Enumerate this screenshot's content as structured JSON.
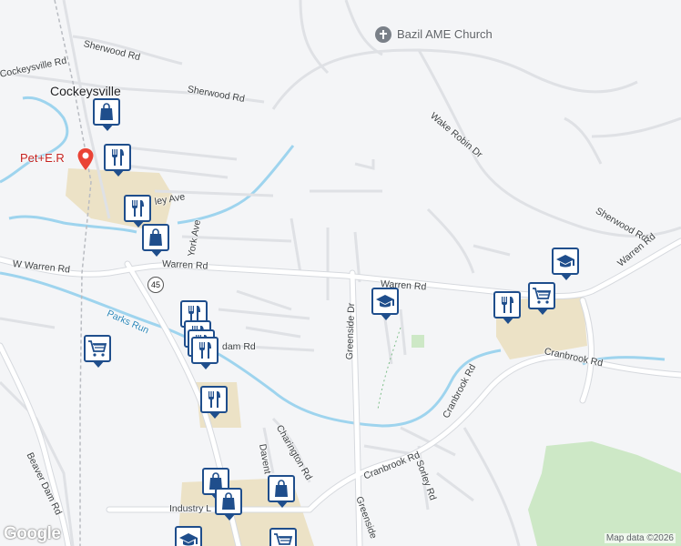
{
  "map": {
    "logo": "Google",
    "attribution": "Map data ©2026",
    "colors": {
      "road": "#ffffff",
      "road_edge": "#d6d9de",
      "water": "#9ed4ee",
      "park": "#cde8c6",
      "commercial": "#ece2c6",
      "marker": "#1f4e8c",
      "pin": "#ea4335"
    }
  },
  "places": {
    "town": "Cockeysville",
    "church": "Bazil AME Church",
    "vet": "Pet+E.R"
  },
  "roads": {
    "sherwood_rd_1": "Sherwood Rd",
    "sherwood_rd_2": "Sherwood Rd",
    "sherwood_rd_3": "Sherwood Rd",
    "cockeysville_rd": "Cockeysville Rd",
    "wake_robin_dr": "Wake Robin Dr",
    "valley_ave": "ley Ave",
    "york_ave": "York Ave",
    "warren_rd_w": "W Warren Rd",
    "warren_rd": "Warren Rd",
    "warren_rd_mid": "Warren Rd",
    "warren_rd_e": "Warren Rd",
    "parks_run": "Parks Run",
    "greenside_dr": "Greenside Dr",
    "greenside_dr_2": "Greenside",
    "dam_rd": "dam Rd",
    "cranbrook_rd_1": "Cranbrook Rd",
    "cranbrook_rd_2": "Cranbrook Rd",
    "cranbrook_rd_3": "Cranbrook Rd",
    "charington_rd": "Charington Rd",
    "daventry": "Davent",
    "beaver_dam_rd": "Beaver Dam Rd",
    "sorley_rd": "Sorley Rd",
    "industry_ln": "Industry L",
    "route_45": "45"
  },
  "markers": [
    {
      "type": "shopping-bag",
      "name": "shopping-marker"
    },
    {
      "type": "restaurant",
      "name": "restaurant-marker"
    },
    {
      "type": "restaurant",
      "name": "restaurant-marker"
    },
    {
      "type": "shopping-bag",
      "name": "shopping-marker"
    },
    {
      "type": "school",
      "name": "school-marker"
    },
    {
      "type": "school",
      "name": "school-marker"
    },
    {
      "type": "restaurant",
      "name": "restaurant-marker"
    },
    {
      "type": "grocery",
      "name": "grocery-marker"
    },
    {
      "type": "restaurant",
      "name": "restaurant-marker"
    },
    {
      "type": "restaurant",
      "name": "restaurant-marker"
    },
    {
      "type": "grocery",
      "name": "grocery-marker"
    },
    {
      "type": "restaurant",
      "name": "restaurant-marker"
    },
    {
      "type": "restaurant",
      "name": "restaurant-marker"
    },
    {
      "type": "restaurant",
      "name": "restaurant-marker"
    },
    {
      "type": "shopping-bag",
      "name": "shopping-marker"
    },
    {
      "type": "shopping-bag",
      "name": "shopping-marker"
    },
    {
      "type": "shopping-bag",
      "name": "shopping-marker"
    },
    {
      "type": "school",
      "name": "school-marker"
    },
    {
      "type": "grocery",
      "name": "grocery-marker"
    }
  ]
}
